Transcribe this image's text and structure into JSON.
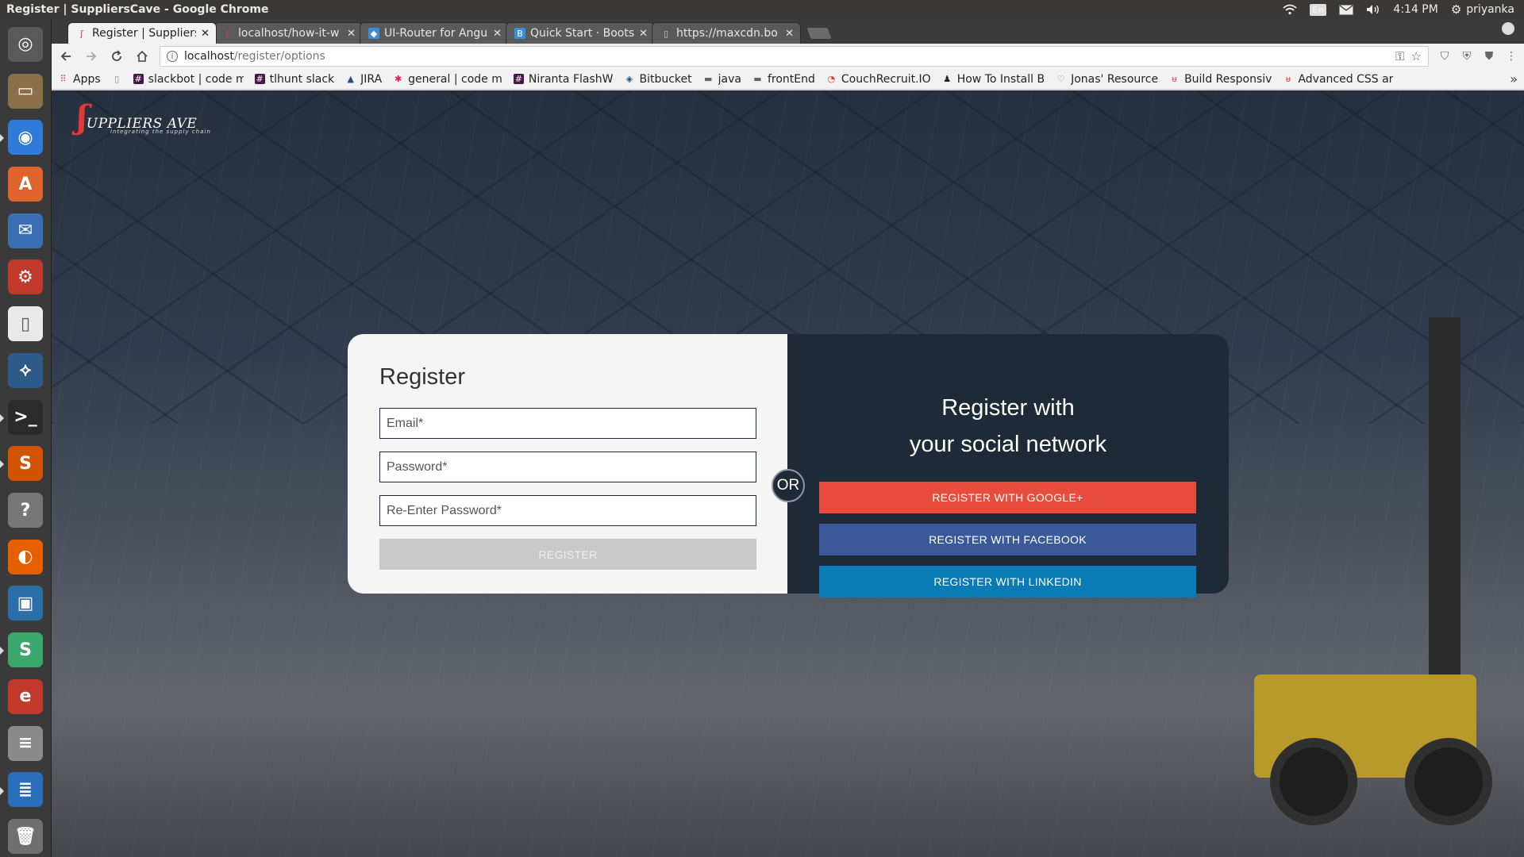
{
  "os": {
    "window_title": "Register | SuppliersCave - Google Chrome",
    "keyboard_layout": "En",
    "clock": "4:14 PM",
    "user": "priyanka"
  },
  "launcher": [
    {
      "name": "ubuntu-dash-icon",
      "color": "#5a5a5a",
      "glyph": "◎"
    },
    {
      "name": "files-icon",
      "color": "#8b6e4a",
      "glyph": "▭"
    },
    {
      "name": "chrome-icon",
      "color": "#2f7bd8",
      "glyph": "◉"
    },
    {
      "name": "software-center-icon",
      "color": "#e0632d",
      "glyph": "A"
    },
    {
      "name": "thunderbird-icon",
      "color": "#3b6fb3",
      "glyph": "✉"
    },
    {
      "name": "system-settings-icon",
      "color": "#c0392b",
      "glyph": "⚙"
    },
    {
      "name": "text-editor-icon",
      "color": "#e9e9e9",
      "glyph": "▯"
    },
    {
      "name": "mysql-workbench-icon",
      "color": "#2c5b8a",
      "glyph": "⟡"
    },
    {
      "name": "terminal-icon",
      "color": "#2b2b2b",
      "glyph": ">_"
    },
    {
      "name": "sublime-text-icon",
      "color": "#d35400",
      "glyph": "S"
    },
    {
      "name": "help-icon",
      "color": "#777777",
      "glyph": "?"
    },
    {
      "name": "firefox-icon",
      "color": "#e66000",
      "glyph": "◐"
    },
    {
      "name": "remote-desktop-icon",
      "color": "#2c6ea8",
      "glyph": "▣"
    },
    {
      "name": "slack-icon",
      "color": "#3aa76d",
      "glyph": "S"
    },
    {
      "name": "text-app-icon",
      "color": "#c0392b",
      "glyph": "e"
    },
    {
      "name": "database-icon",
      "color": "#8a8a8a",
      "glyph": "≡"
    },
    {
      "name": "writer-icon",
      "color": "#2a6ebb",
      "glyph": "≣"
    },
    {
      "name": "trash-icon",
      "color": "#707070",
      "glyph": "🗑"
    }
  ],
  "tabs": [
    {
      "title": "Register | Suppliers",
      "favicon": "suppliers-cave-favicon",
      "active": true
    },
    {
      "title": "localhost/how-it-w",
      "favicon": "suppliers-cave-favicon",
      "active": false
    },
    {
      "title": "UI-Router for Angu",
      "favicon": "ui-router-favicon",
      "active": false
    },
    {
      "title": "Quick Start · Boots",
      "favicon": "bootstrap-favicon",
      "active": false
    },
    {
      "title": "https://maxcdn.bo",
      "favicon": "page-favicon",
      "active": false
    }
  ],
  "omnibox": {
    "host": "localhost",
    "path": "/register/options"
  },
  "bookmarks": [
    {
      "label": "Apps",
      "icon": "apps-grid-icon",
      "color": "#e34b3a"
    },
    {
      "label": "",
      "icon": "page-icon",
      "color": "#888888"
    },
    {
      "label": "slackbot | code m",
      "icon": "slack-favicon",
      "color": "#4a154b"
    },
    {
      "label": "tlhunt slack",
      "icon": "slack-favicon",
      "color": "#4a154b"
    },
    {
      "label": "JIRA",
      "icon": "jira-favicon",
      "color": "#205081"
    },
    {
      "label": "general | code m",
      "icon": "slack-color-favicon",
      "color": "#e01e5a"
    },
    {
      "label": "Niranta FlashW",
      "icon": "slack-favicon",
      "color": "#4a154b"
    },
    {
      "label": "Bitbucket",
      "icon": "bitbucket-favicon",
      "color": "#205081"
    },
    {
      "label": "java",
      "icon": "folder-icon",
      "color": "#666666"
    },
    {
      "label": "frontEnd",
      "icon": "folder-icon",
      "color": "#666666"
    },
    {
      "label": "CouchRecruit.IO",
      "icon": "couch-favicon",
      "color": "#e53935"
    },
    {
      "label": "How To Install B",
      "icon": "linux-favicon",
      "color": "#222222"
    },
    {
      "label": "Jonas' Resource",
      "icon": "jonas-favicon",
      "color": "#3aa0d8"
    },
    {
      "label": "Build Responsiv",
      "icon": "udemy-favicon",
      "color": "#e53935"
    },
    {
      "label": "Advanced CSS ar",
      "icon": "udemy-favicon",
      "color": "#e53935"
    }
  ],
  "page": {
    "logo": {
      "text": "UPPLIERS AVE",
      "tagline": "integrating the supply chain"
    },
    "form": {
      "title": "Register",
      "email_placeholder": "Email*",
      "password_placeholder": "Password*",
      "repassword_placeholder": "Re-Enter Password*",
      "submit_label": "REGISTER"
    },
    "or_label": "OR",
    "social": {
      "title_line1": "Register with",
      "title_line2": "your social network",
      "google_label": "REGISTER WITH GOOGLE+",
      "facebook_label": "REGISTER WITH FACEBOOK",
      "linkedin_label": "REGISTER WITH LINKEDIN",
      "google_color": "#e74c3c",
      "facebook_color": "#3b5998",
      "linkedin_color": "#0a7bb5"
    }
  }
}
